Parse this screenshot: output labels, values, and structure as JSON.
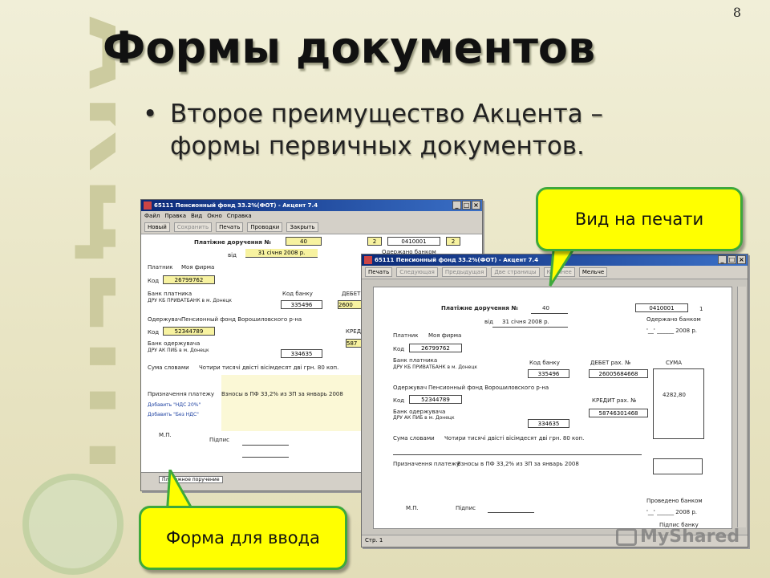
{
  "page_number": "8",
  "title": "Формы документов",
  "bullet": {
    "symbol": "•",
    "line1": "Второе преимущество Акцента –",
    "line2": "формы первичных документов."
  },
  "side_logo": "АКЦЕНТ",
  "callouts": {
    "print_view": "Вид на печати",
    "input_form": "Форма для ввода"
  },
  "watermark": "MyShared",
  "input_window": {
    "title": "65111 Пенсионный фонд 33.2%(ФОТ) - Акцент 7.4",
    "menu": [
      "Файл",
      "Правка",
      "Вид",
      "Окно",
      "Справка"
    ],
    "toolbar": [
      "Новый",
      "Сохранить",
      "Печать",
      "Проводки",
      "Закрыть"
    ],
    "form": {
      "heading": "Платіжне доручення №",
      "number": "40",
      "date_label": "від",
      "date": "31 січня 2008 р.",
      "box_code": "2",
      "box_form": "0410001",
      "box_copy": "2",
      "received": "Одержано банком",
      "payer_label": "Платник",
      "payer": "Моя фирма",
      "code_label": "Код",
      "payer_code": "26799762",
      "payer_bank_label": "Банк платника",
      "payer_bank": "ДРУ КБ ПРИВАТБАНК в м. Донецк",
      "bank_code_label": "Код банку",
      "debit_label": "ДЕБЕТ",
      "payer_bank_code": "335496",
      "debit_value": "2600",
      "payee_label": "Одержувач",
      "payee": "Пенсионный фонд Ворошиловского р-на",
      "payee_code": "52344789",
      "credit_label": "КРЕД",
      "payee_bank_label": "Банк одержувача",
      "payee_bank": "ДРУ АК ПИБ в м. Донецк",
      "payee_bank_code": "334635",
      "credit_value": "587",
      "words_label": "Сума словами",
      "words": "Чотири тисячі двісті вісімдесят дві грн. 80 коп.",
      "purpose_label": "Призначення платежу",
      "purpose": "Взносы в ПФ 33,2% из ЗП за январь 2008",
      "link_nds": "Добавить \"НДС 20%\"",
      "link_no_nds": "Добавить \"Без НДС\"",
      "mp": "М.П.",
      "sign": "Підпис",
      "tab": "Платежное поручение"
    }
  },
  "print_window": {
    "title": "65111 Пенсионный фонд 33.2%(ФОТ) - Акцент 7.4",
    "toolbar": [
      "Печать",
      "Следующая",
      "Предыдущая",
      "Две страницы",
      "Крупнее",
      "Мельче"
    ],
    "status": "Стр. 1",
    "form": {
      "heading": "Платіжне доручення №",
      "number": "40",
      "date_label": "від",
      "date": "31 січня 2008 р.",
      "box_form": "0410001",
      "box_copy": "1",
      "received": "Одержано банком",
      "received_date": "'__' ______ 2008 р.",
      "payer_label": "Платник",
      "payer": "Моя фирма",
      "code_label": "Код",
      "payer_code": "26799762",
      "payer_bank_label": "Банк платника",
      "payer_bank": "ДРУ КБ ПРИВАТБАНК в м. Донецк",
      "bank_code_label": "Код банку",
      "debit_label": "ДЕБЕТ рах. №",
      "sum_label": "СУМА",
      "payer_bank_code": "335496",
      "debit_value": "26005684668",
      "payee_label": "Одержувач",
      "payee": "Пенсионный фонд Ворошиловского р-на",
      "payee_code": "52344789",
      "credit_label": "КРЕДИТ рах. №",
      "sum_value": "4282,80",
      "payee_bank_label": "Банк одержувача",
      "payee_bank": "ДРУ АК ПИБ в м. Донецк",
      "payee_bank_code": "334635",
      "credit_value": "58746301468",
      "words_label": "Сума словами",
      "words": "Чотири тисячі двісті вісімдесят дві грн. 80 коп.",
      "purpose_label": "Призначення платежу",
      "purpose": "Взносы в ПФ 33,2% из ЗП за январь 2008",
      "mp": "М.П.",
      "sign": "Підпис",
      "posted": "Проведено банком",
      "posted_date": "'__' ______ 2008 р.",
      "bank_sign": "Підпис банку"
    }
  }
}
